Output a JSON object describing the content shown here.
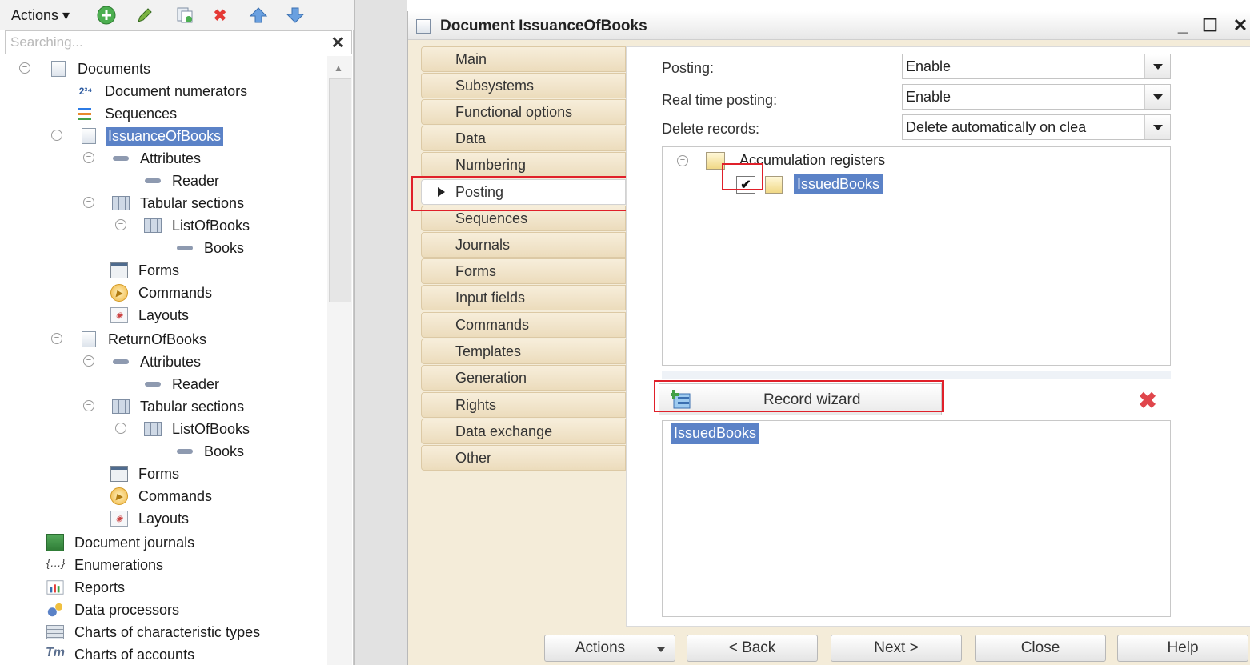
{
  "left_toolbar": {
    "actions_label": "Actions ▾"
  },
  "search": {
    "placeholder": "Searching..."
  },
  "tree": {
    "documents": "Documents",
    "document_numerators": "Document numerators",
    "sequences": "Sequences",
    "issuance": {
      "name": "IssuanceOfBooks",
      "attributes": "Attributes",
      "reader": "Reader",
      "tabular_sections": "Tabular sections",
      "list_of_books": "ListOfBooks",
      "books": "Books",
      "forms": "Forms",
      "commands": "Commands",
      "layouts": "Layouts"
    },
    "return": {
      "name": "ReturnOfBooks",
      "attributes": "Attributes",
      "reader": "Reader",
      "tabular_sections": "Tabular sections",
      "list_of_books": "ListOfBooks",
      "books": "Books",
      "forms": "Forms",
      "commands": "Commands",
      "layouts": "Layouts"
    },
    "document_journals": "Document journals",
    "enumerations": "Enumerations",
    "reports": "Reports",
    "data_processors": "Data processors",
    "charts_of_characteristic_types": "Charts of characteristic types",
    "charts_of_accounts": "Charts of accounts"
  },
  "window": {
    "title": "Document IssuanceOfBooks",
    "minimize": "_",
    "maximize": "☐",
    "close": "✕"
  },
  "tabs": [
    "Main",
    "Subsystems",
    "Functional options",
    "Data",
    "Numbering",
    "Posting",
    "Sequences",
    "Journals",
    "Forms",
    "Input fields",
    "Commands",
    "Templates",
    "Generation",
    "Rights",
    "Data exchange",
    "Other"
  ],
  "posting": {
    "posting_label": "Posting:",
    "posting_value": "Enable",
    "realtime_label": "Real time posting:",
    "realtime_value": "Enable",
    "delete_label": "Delete records:",
    "delete_value": "Delete automatically on clea",
    "registers_root": "Accumulation registers",
    "register_item": "IssuedBooks",
    "record_wizard": "Record wizard",
    "movement_item": "IssuedBooks"
  },
  "buttons": {
    "actions": "Actions",
    "back": "< Back",
    "next": "Next >",
    "close": "Close",
    "help": "Help"
  },
  "colors": {
    "selection": "#5b82c7",
    "highlight_frame": "#e0202a",
    "tab_background": "#f4ecd9",
    "remove_icon": "#e0464c"
  }
}
